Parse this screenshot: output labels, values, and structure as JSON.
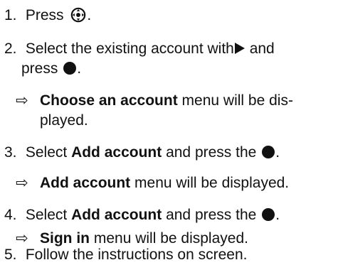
{
  "steps": [
    {
      "number": "1.",
      "text_before": "Press",
      "icon": "dpad-center-icon",
      "text_after": "."
    },
    {
      "number": "2.",
      "line1_text": "Select the existing account with",
      "line1_icon": "play-right-icon",
      "line1_after": "and",
      "line2_text": "press",
      "line2_icon": "round-button-icon",
      "line2_after": "."
    },
    {
      "result_symbol": "⇨",
      "result_bold": "Choose an account",
      "result_line1_rest": "menu will be dis-",
      "result_line2": "played."
    },
    {
      "number": "3.",
      "text": "Select",
      "bold": "Add account",
      "text_mid": "and press the",
      "icon": "round-button-icon",
      "text_after": "."
    },
    {
      "result_symbol": "⇨",
      "result_bold": "Add account",
      "result_rest": "menu will be displayed."
    },
    {
      "number": "4.",
      "text": "Select",
      "bold": "Add account",
      "text_mid": "and press the",
      "icon": "round-button-icon",
      "text_after": "."
    },
    {
      "result_symbol": "⇨",
      "result_bold": "Sign in",
      "result_rest": "menu will be displayed."
    },
    {
      "number": "5.",
      "text": "Follow the instructions on screen."
    }
  ],
  "colors": {
    "text": "#111111",
    "background": "#ffffff"
  }
}
